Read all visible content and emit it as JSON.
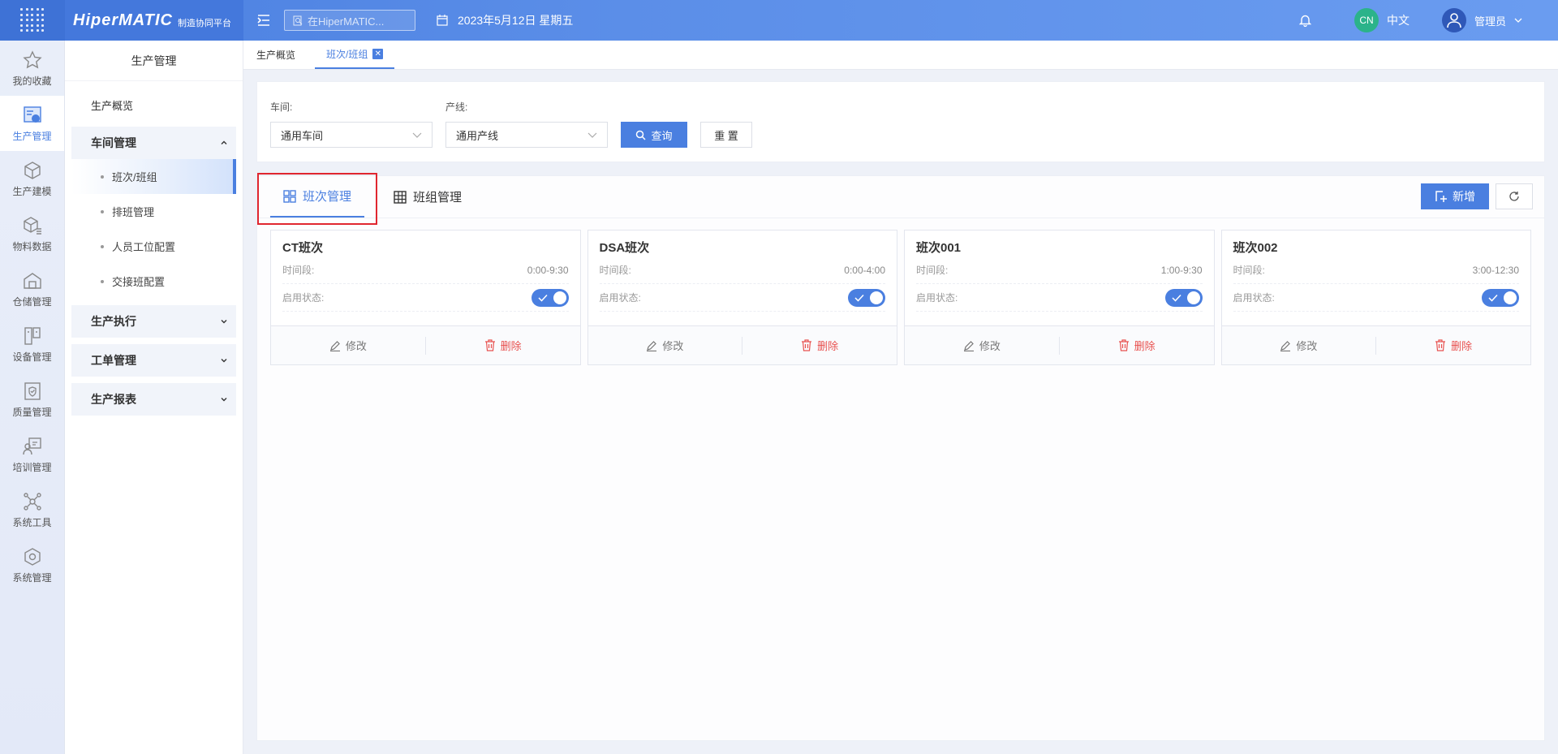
{
  "topbar": {
    "logo_name": "HiperMATIC",
    "logo_sub": "制造协同平台",
    "search_placeholder": "在HiperMATIC...",
    "date": "2023年5月12日 星期五",
    "lang_badge": "CN",
    "lang_label": "中文",
    "user_name": "管理员"
  },
  "rail": {
    "items": [
      {
        "label": "我的收藏",
        "icon": "star-icon"
      },
      {
        "label": "生产管理",
        "icon": "production-icon"
      },
      {
        "label": "生产建模",
        "icon": "cube-icon"
      },
      {
        "label": "物料数据",
        "icon": "material-icon"
      },
      {
        "label": "仓储管理",
        "icon": "warehouse-icon"
      },
      {
        "label": "设备管理",
        "icon": "device-icon"
      },
      {
        "label": "质量管理",
        "icon": "quality-icon"
      },
      {
        "label": "培训管理",
        "icon": "training-icon"
      },
      {
        "label": "系统工具",
        "icon": "tools-icon"
      },
      {
        "label": "系统管理",
        "icon": "settings-icon"
      }
    ]
  },
  "sidemenu": {
    "title": "生产管理",
    "overview": "生产概览",
    "group_workshop": "车间管理",
    "sub_items": [
      "班次/班组",
      "排班管理",
      "人员工位配置",
      "交接班配置"
    ],
    "group_execution": "生产执行",
    "group_workorder": "工单管理",
    "group_report": "生产报表"
  },
  "tabstrip": {
    "tab1": "生产概览",
    "tab2": "班次/班组",
    "close_glyph": "✕"
  },
  "filter": {
    "workshop_label": "车间:",
    "workshop_value": "通用车间",
    "line_label": "产线:",
    "line_value": "通用产线",
    "query_label": "查询",
    "reset_label": "重 置"
  },
  "main": {
    "tab_shift": "班次管理",
    "tab_team": "班组管理",
    "add_label": "新增",
    "time_label": "时间段:",
    "status_label": "启用状态:",
    "edit_label": "修改",
    "delete_label": "删除",
    "cards": [
      {
        "name": "CT班次",
        "time": "0:00-9:30",
        "enabled": true
      },
      {
        "name": "DSA班次",
        "time": "0:00-4:00",
        "enabled": true
      },
      {
        "name": "班次001",
        "time": "1:00-9:30",
        "enabled": true
      },
      {
        "name": "班次002",
        "time": "3:00-12:30",
        "enabled": true
      }
    ]
  },
  "colors": {
    "primary": "#4a7fe0",
    "danger": "#e8514f",
    "highlight": "#e0262f"
  }
}
